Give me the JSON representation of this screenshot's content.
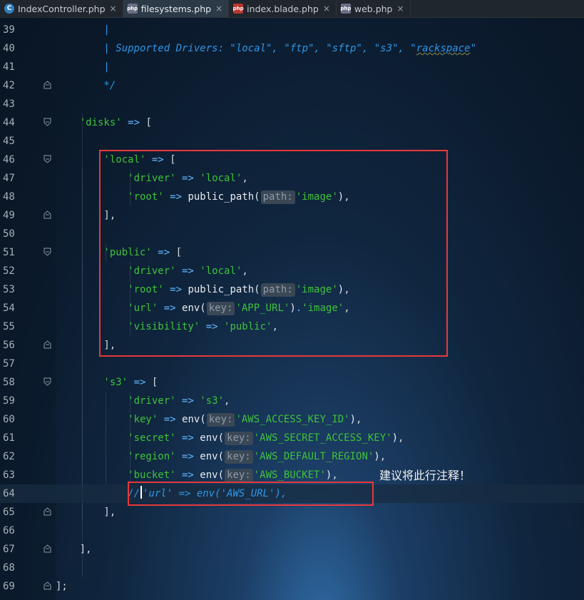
{
  "tabs": [
    {
      "name": "IndexController.php",
      "icon": "class-icon",
      "glyph": "C",
      "active": false
    },
    {
      "name": "filesystems.php",
      "icon": "php-file-icon",
      "glyph": "php",
      "active": true
    },
    {
      "name": "index.blade.php",
      "icon": "blade-file-icon",
      "glyph": "php",
      "active": false
    },
    {
      "name": "web.php",
      "icon": "php-file-icon",
      "glyph": "php",
      "active": false
    }
  ],
  "tab_close": "×",
  "first_line": 39,
  "lines": [
    {
      "n": "39",
      "fold": "",
      "tokens": [
        [
          "cm",
          "        |"
        ]
      ]
    },
    {
      "n": "40",
      "fold": "",
      "tokens": [
        [
          "cm",
          "        | Supported Drivers: \"local\", \"ftp\", \"sftp\", \"s3\", \""
        ],
        [
          "cmw",
          "rackspace"
        ],
        [
          "cm",
          "\""
        ]
      ]
    },
    {
      "n": "41",
      "fold": "",
      "tokens": [
        [
          "cm",
          "        |"
        ]
      ]
    },
    {
      "n": "42",
      "fold": "end",
      "tokens": [
        [
          "cm",
          "        */"
        ]
      ]
    },
    {
      "n": "43",
      "fold": "",
      "tokens": []
    },
    {
      "n": "44",
      "fold": "start",
      "tokens": [
        [
          "str",
          "    'disks'"
        ],
        [
          "op",
          " => "
        ],
        [
          "txt",
          "["
        ]
      ]
    },
    {
      "n": "45",
      "fold": "",
      "tokens": []
    },
    {
      "n": "46",
      "fold": "start",
      "tokens": [
        [
          "str",
          "        'local'"
        ],
        [
          "op",
          " => "
        ],
        [
          "txt",
          "["
        ]
      ]
    },
    {
      "n": "47",
      "fold": "",
      "tokens": [
        [
          "str",
          "            'driver'"
        ],
        [
          "op",
          " => "
        ],
        [
          "str",
          "'local'"
        ],
        [
          "txt",
          ","
        ]
      ]
    },
    {
      "n": "48",
      "fold": "",
      "tokens": [
        [
          "str",
          "            'root'"
        ],
        [
          "op",
          " => "
        ],
        [
          "fn",
          "public_path("
        ],
        [
          "hint",
          "path:"
        ],
        [
          "str",
          "'image'"
        ],
        [
          "fn",
          ")"
        ],
        [
          "txt",
          ","
        ]
      ]
    },
    {
      "n": "49",
      "fold": "end",
      "tokens": [
        [
          "txt",
          "        ],"
        ]
      ]
    },
    {
      "n": "50",
      "fold": "",
      "tokens": []
    },
    {
      "n": "51",
      "fold": "start",
      "tokens": [
        [
          "str",
          "        'public'"
        ],
        [
          "op",
          " => "
        ],
        [
          "txt",
          "["
        ]
      ]
    },
    {
      "n": "52",
      "fold": "",
      "tokens": [
        [
          "str",
          "            'driver'"
        ],
        [
          "op",
          " => "
        ],
        [
          "str",
          "'local'"
        ],
        [
          "txt",
          ","
        ]
      ]
    },
    {
      "n": "53",
      "fold": "",
      "tokens": [
        [
          "str",
          "            'root'"
        ],
        [
          "op",
          " => "
        ],
        [
          "fn",
          "public_path("
        ],
        [
          "hint",
          "path:"
        ],
        [
          "str",
          "'image'"
        ],
        [
          "fn",
          ")"
        ],
        [
          "txt",
          ","
        ]
      ]
    },
    {
      "n": "54",
      "fold": "",
      "tokens": [
        [
          "str",
          "            'url'"
        ],
        [
          "op",
          " => "
        ],
        [
          "fn",
          "env("
        ],
        [
          "hint",
          "key:"
        ],
        [
          "str",
          "'APP_URL'"
        ],
        [
          "fn",
          ")"
        ],
        [
          "op",
          "."
        ],
        [
          "str",
          "'image'"
        ],
        [
          "txt",
          ","
        ]
      ]
    },
    {
      "n": "55",
      "fold": "",
      "tokens": [
        [
          "str",
          "            'visibility'"
        ],
        [
          "op",
          " => "
        ],
        [
          "str",
          "'public'"
        ],
        [
          "txt",
          ","
        ]
      ]
    },
    {
      "n": "56",
      "fold": "end",
      "tokens": [
        [
          "txt",
          "        ],"
        ]
      ]
    },
    {
      "n": "57",
      "fold": "",
      "tokens": []
    },
    {
      "n": "58",
      "fold": "start",
      "tokens": [
        [
          "str",
          "        's3'"
        ],
        [
          "op",
          " => "
        ],
        [
          "txt",
          "["
        ]
      ]
    },
    {
      "n": "59",
      "fold": "",
      "tokens": [
        [
          "str",
          "            'driver'"
        ],
        [
          "op",
          " => "
        ],
        [
          "str",
          "'s3'"
        ],
        [
          "txt",
          ","
        ]
      ]
    },
    {
      "n": "60",
      "fold": "",
      "tokens": [
        [
          "str",
          "            'key'"
        ],
        [
          "op",
          " => "
        ],
        [
          "fn",
          "env("
        ],
        [
          "hint",
          "key:"
        ],
        [
          "str",
          "'AWS_ACCESS_KEY_ID'"
        ],
        [
          "fn",
          ")"
        ],
        [
          "txt",
          ","
        ]
      ]
    },
    {
      "n": "61",
      "fold": "",
      "tokens": [
        [
          "str",
          "            'secret'"
        ],
        [
          "op",
          " => "
        ],
        [
          "fn",
          "env("
        ],
        [
          "hint",
          "key:"
        ],
        [
          "str",
          "'AWS_SECRET_ACCESS_KEY'"
        ],
        [
          "fn",
          ")"
        ],
        [
          "txt",
          ","
        ]
      ]
    },
    {
      "n": "62",
      "fold": "",
      "tokens": [
        [
          "str",
          "            'region'"
        ],
        [
          "op",
          " => "
        ],
        [
          "fn",
          "env("
        ],
        [
          "hint",
          "key:"
        ],
        [
          "str",
          "'AWS_DEFAULT_REGION'"
        ],
        [
          "fn",
          ")"
        ],
        [
          "txt",
          ","
        ]
      ]
    },
    {
      "n": "63",
      "fold": "",
      "tokens": [
        [
          "str",
          "            'bucket'"
        ],
        [
          "op",
          " => "
        ],
        [
          "fn",
          "env("
        ],
        [
          "hint",
          "key:"
        ],
        [
          "str",
          "'AWS_BUCKET'"
        ],
        [
          "fn",
          ")"
        ],
        [
          "txt",
          ","
        ]
      ]
    },
    {
      "n": "64",
      "fold": "",
      "current": true,
      "tokens": [
        [
          "cml",
          "            //"
        ],
        [
          "caret",
          ""
        ],
        [
          "cml",
          "'url' => env('AWS_URL'),"
        ]
      ]
    },
    {
      "n": "65",
      "fold": "end",
      "tokens": [
        [
          "txt",
          "        ],"
        ]
      ]
    },
    {
      "n": "66",
      "fold": "",
      "tokens": []
    },
    {
      "n": "67",
      "fold": "end",
      "tokens": [
        [
          "txt",
          "    ],"
        ]
      ]
    },
    {
      "n": "68",
      "fold": "",
      "tokens": []
    },
    {
      "n": "69",
      "fold": "end",
      "tokens": [
        [
          "txt",
          "];"
        ]
      ]
    }
  ],
  "annotation": "建议将此行注释！",
  "colors": {
    "highlight_box": "#e8393a",
    "string": "#3fc23a",
    "comment": "#2e96e6"
  }
}
